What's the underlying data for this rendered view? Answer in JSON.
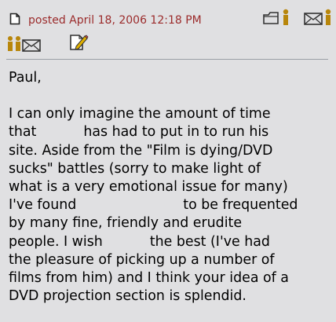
{
  "post": {
    "posted_text": "posted April 18, 2006 12:18 PM",
    "icons": {
      "document": "document-icon",
      "profile": "profile-icon",
      "email": "email-icon",
      "private_message": "private-message-icon",
      "edit": "edit-icon"
    },
    "colors": {
      "posted_text": "#9b2b2b",
      "background": "#e0e0e2",
      "icon_outline": "#333333",
      "icon_person": "#b8860b",
      "divider": "#9aa0a6"
    }
  },
  "message": {
    "greeting": "Paul,",
    "lines": [
      "I can only imagine the amount of time",
      "has had to put in to run his",
      "site. Aside from the \"Film is dying/DVD",
      "sucks\" battles (sorry to make light of",
      "what is a very emotional issue for many)",
      "I've found",
      "to be frequented",
      "by many fine, friendly and erudite",
      "people. I wish",
      "the best (I've had",
      "the pleasure of picking up a number of",
      "films from him) and I think your idea of a",
      "DVD projection section is splendid."
    ],
    "words": {
      "that": "that"
    }
  }
}
